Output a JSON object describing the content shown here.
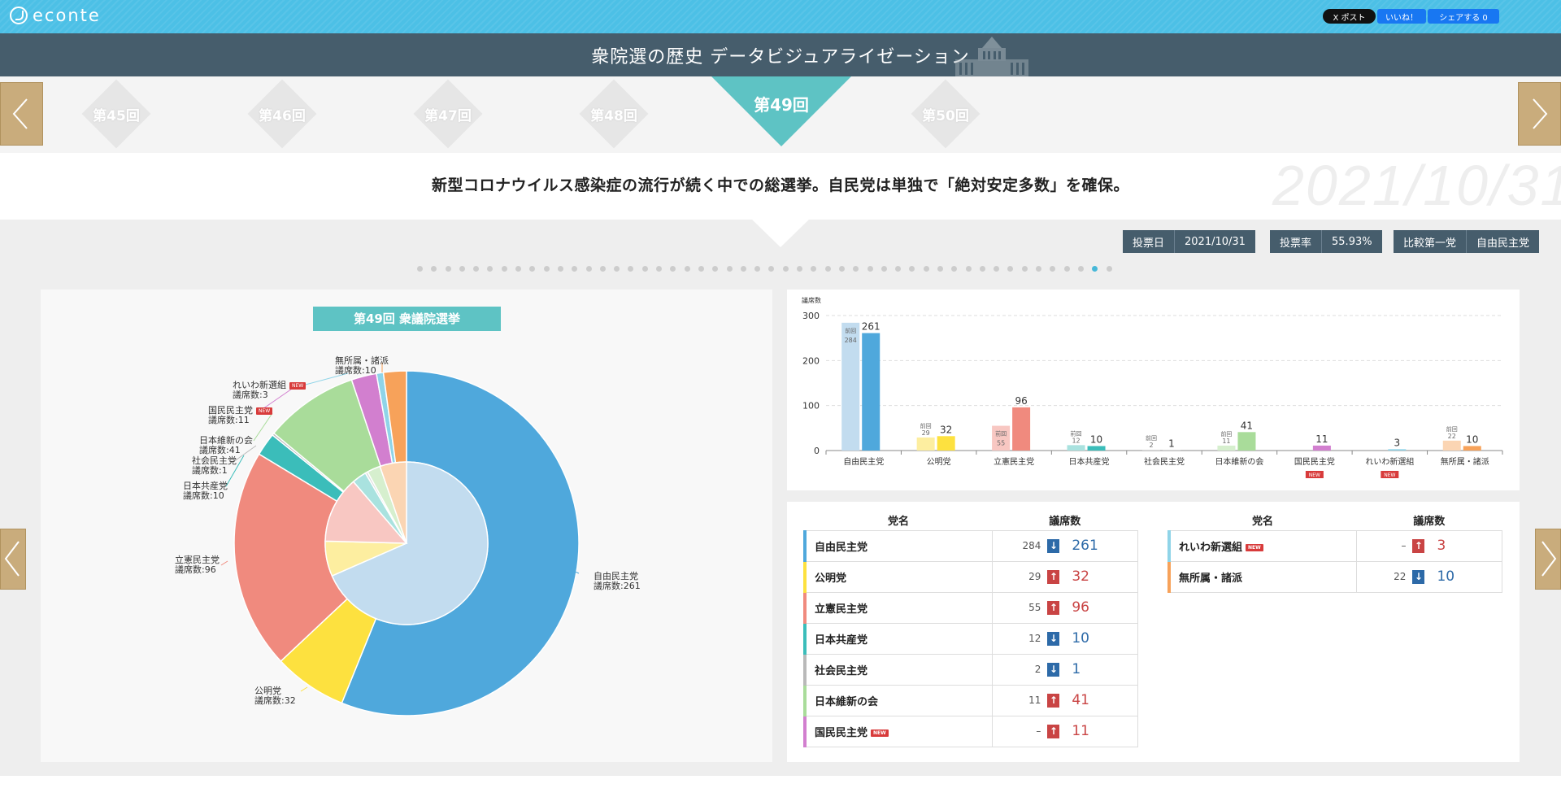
{
  "brand": {
    "name": "econte"
  },
  "social": {
    "x": "X ポスト",
    "like": "いいね！",
    "share": "シェアする 0"
  },
  "title": "衆院選の歴史 データビジュアライゼーション",
  "nav": {
    "items": [
      "第45回",
      "第46回",
      "第47回",
      "第48回",
      "第49回",
      "第50回"
    ],
    "active": "第49回"
  },
  "headline": "新型コロナウイルス感染症の流行が続く中での総選挙。自民党は単独で「絶対安定多数」を確保。",
  "big_date": "2021/10/31",
  "tags": {
    "vote_day_label": "投票日",
    "vote_day": "2021/10/31",
    "turnout_label": "投票率",
    "turnout": "55.93%",
    "compare_label": "比較第一党",
    "compare": "自由民主党"
  },
  "timeline": {
    "count": 50,
    "active_index": 48
  },
  "pie": {
    "title": "第49回 衆議院選挙",
    "seat_prefix": "議席数:",
    "labels": [
      {
        "name": "自由民主党",
        "seats": "261"
      },
      {
        "name": "公明党",
        "seats": "32"
      },
      {
        "name": "立憲民主党",
        "seats": "96"
      },
      {
        "name": "日本共産党",
        "seats": "10"
      },
      {
        "name": "社会民主党",
        "seats": "1"
      },
      {
        "name": "日本維新の会",
        "seats": "41"
      },
      {
        "name": "国民民主党",
        "seats": "11"
      },
      {
        "name": "れいわ新選組",
        "seats": "3"
      },
      {
        "name": "無所属・諸派",
        "seats": "10"
      }
    ],
    "new_badge": "NEW"
  },
  "chart_data": {
    "type": "bar",
    "ylabel": "議席数",
    "ylim": [
      0,
      300
    ],
    "yticks": [
      0,
      100,
      200,
      300
    ],
    "categories": [
      "自由民主党",
      "公明党",
      "立憲民主党",
      "日本共産党",
      "社会民主党",
      "日本維新の会",
      "国民民主党",
      "れいわ新選組",
      "無所属・諸派"
    ],
    "series": [
      {
        "name": "前回",
        "values": [
          284,
          29,
          55,
          12,
          2,
          11,
          null,
          null,
          22
        ]
      },
      {
        "name": "第49回",
        "values": [
          261,
          32,
          96,
          10,
          1,
          41,
          11,
          3,
          10
        ]
      }
    ],
    "prev_label": "前回",
    "new_badge_categories": [
      "国民民主党",
      "れいわ新選組"
    ],
    "colors": [
      "#4fa8dc",
      "#fde13f",
      "#f08a7e",
      "#3bbdba",
      "#b9b9b9",
      "#a9dc9a",
      "#d27fcf",
      "#8fd4e8",
      "#f7a25a"
    ],
    "light_colors": [
      "#c2dcef",
      "#fdeea0",
      "#f8c7c2",
      "#a9e2df",
      "#dddddd",
      "#d6efce",
      "#eac6e9",
      "#c7eaf4",
      "#fbd5b3"
    ]
  },
  "inner_ring": {
    "values": [
      284,
      29,
      55,
      12,
      2,
      11,
      0,
      0,
      22
    ]
  },
  "table": {
    "col_party": "党名",
    "col_seats": "議席数",
    "rows": [
      {
        "name": "自由民主党",
        "prev": "284",
        "dir": "down",
        "val": "261",
        "color": "#4fa8dc",
        "new": false
      },
      {
        "name": "公明党",
        "prev": "29",
        "dir": "up",
        "val": "32",
        "color": "#fde13f",
        "new": false
      },
      {
        "name": "立憲民主党",
        "prev": "55",
        "dir": "up",
        "val": "96",
        "color": "#f08a7e",
        "new": false
      },
      {
        "name": "日本共産党",
        "prev": "12",
        "dir": "down",
        "val": "10",
        "color": "#3bbdba",
        "new": false
      },
      {
        "name": "社会民主党",
        "prev": "2",
        "dir": "down",
        "val": "1",
        "color": "#b9b9b9",
        "new": false
      },
      {
        "name": "日本維新の会",
        "prev": "11",
        "dir": "up",
        "val": "41",
        "color": "#a9dc9a",
        "new": false
      },
      {
        "name": "国民民主党",
        "prev": "–",
        "dir": "up",
        "val": "11",
        "color": "#d27fcf",
        "new": true
      },
      {
        "name": "れいわ新選組",
        "prev": "–",
        "dir": "up",
        "val": "3",
        "color": "#8fd4e8",
        "new": true
      },
      {
        "name": "無所属・諸派",
        "prev": "22",
        "dir": "down",
        "val": "10",
        "color": "#f7a25a",
        "new": false
      }
    ]
  }
}
